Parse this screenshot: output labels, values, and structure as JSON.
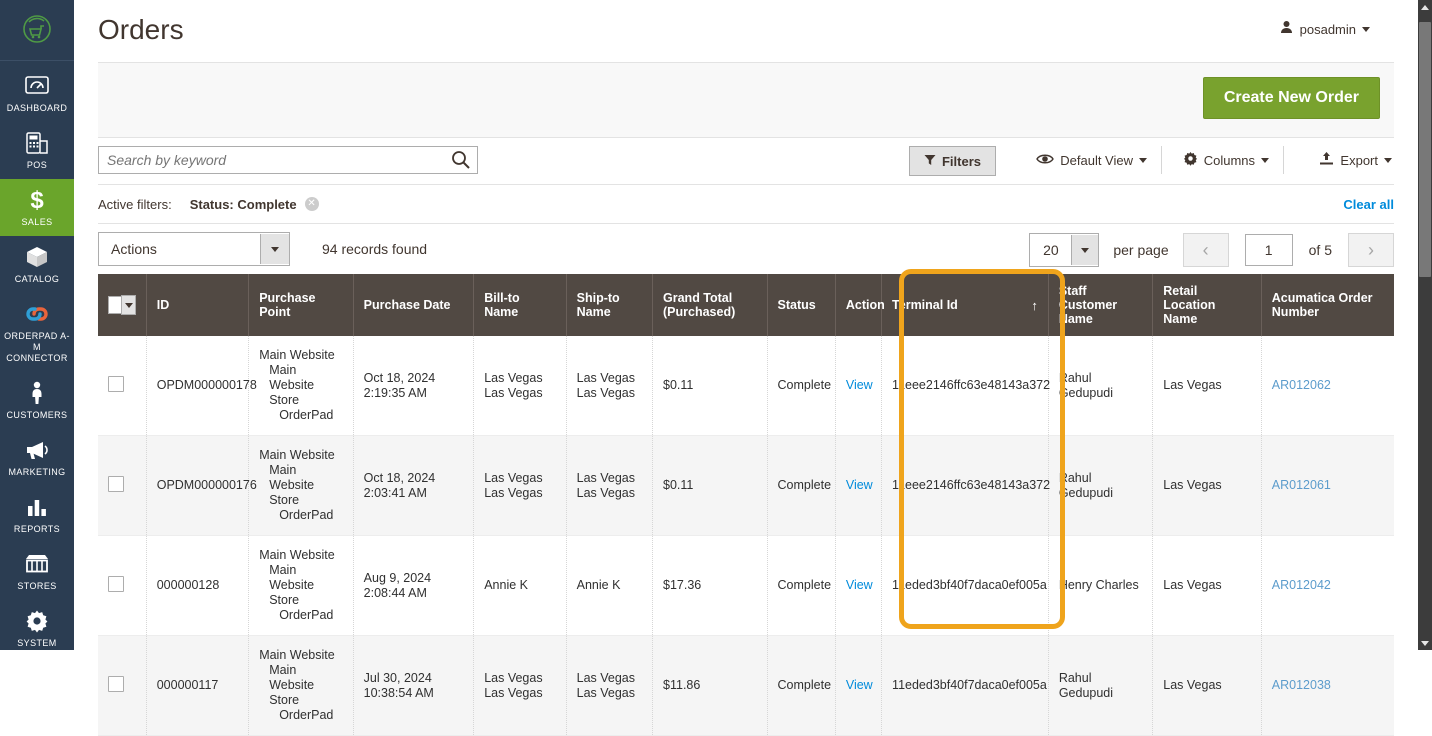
{
  "sidebar": {
    "logo_icon": "orderpad-logo-icon",
    "items": [
      {
        "label": "DASHBOARD",
        "icon": "dashboard-gauge-icon",
        "active": false
      },
      {
        "label": "POS",
        "icon": "pos-terminal-icon",
        "active": false
      },
      {
        "label": "SALES",
        "icon": "dollar-sign-icon",
        "active": true
      },
      {
        "label": "CATALOG",
        "icon": "box-icon",
        "active": false
      },
      {
        "label": "ORDERPAD A-M CONNECTOR",
        "icon": "link-chain-icon",
        "active": false
      },
      {
        "label": "CUSTOMERS",
        "icon": "person-icon",
        "active": false
      },
      {
        "label": "MARKETING",
        "icon": "megaphone-icon",
        "active": false
      },
      {
        "label": "REPORTS",
        "icon": "bar-chart-icon",
        "active": false
      },
      {
        "label": "STORES",
        "icon": "storefront-icon",
        "active": false
      },
      {
        "label": "SYSTEM",
        "icon": "gear-icon",
        "active": false
      }
    ]
  },
  "header": {
    "title": "Orders",
    "user_name": "posadmin"
  },
  "action_bar": {
    "create_order_label": "Create New Order"
  },
  "toolbar": {
    "search_placeholder": "Search by keyword",
    "search_value": "",
    "filters_label": "Filters",
    "default_view_label": "Default View",
    "columns_label": "Columns",
    "export_label": "Export"
  },
  "active_filters": {
    "label": "Active filters:",
    "chips": [
      "Status: Complete"
    ],
    "clear_all_label": "Clear all"
  },
  "pager": {
    "actions_label": "Actions",
    "records_found": "94 records found",
    "per_page_value": "20",
    "per_page_label": "per page",
    "page_value": "1",
    "of_label": "of 5"
  },
  "grid": {
    "columns": [
      "ID",
      "Purchase Point",
      "Purchase Date",
      "Bill-to Name",
      "Ship-to Name",
      "Grand Total (Purchased)",
      "Status",
      "Action",
      "Terminal Id",
      "Staff Customer Name",
      "Retail Location Name",
      "Acumatica Order Number"
    ],
    "sorted_column": "Terminal Id",
    "sort_direction": "ascending",
    "sort_glyph": "↑",
    "purchase_point_lines": [
      "Main Website",
      "Main Website Store",
      "OrderPad"
    ],
    "rows": [
      {
        "id": "OPDM000000178",
        "purchase_date_1": "Oct 18, 2024",
        "purchase_date_2": "2:19:35 AM",
        "bill_to": "Las Vegas Las Vegas",
        "ship_to": "Las Vegas Las Vegas",
        "grand_total": "$0.11",
        "status": "Complete",
        "action": "View",
        "terminal_id": "11eee2146ffc63e48143a372",
        "staff_customer": "Rahul Gedupudi",
        "retail_location": "Las Vegas",
        "acumatica_order": "AR012062"
      },
      {
        "id": "OPDM000000176",
        "purchase_date_1": "Oct 18, 2024",
        "purchase_date_2": "2:03:41 AM",
        "bill_to": "Las Vegas Las Vegas",
        "ship_to": "Las Vegas Las Vegas",
        "grand_total": "$0.11",
        "status": "Complete",
        "action": "View",
        "terminal_id": "11eee2146ffc63e48143a372",
        "staff_customer": "Rahul Gedupudi",
        "retail_location": "Las Vegas",
        "acumatica_order": "AR012061"
      },
      {
        "id": "000000128",
        "purchase_date_1": "Aug 9, 2024",
        "purchase_date_2": "2:08:44 AM",
        "bill_to": "Annie K",
        "ship_to": "Annie K",
        "grand_total": "$17.36",
        "status": "Complete",
        "action": "View",
        "terminal_id": "11eded3bf40f7daca0ef005a",
        "staff_customer": "Henry Charles",
        "retail_location": "Las Vegas",
        "acumatica_order": "AR012042"
      },
      {
        "id": "000000117",
        "purchase_date_1": "Jul 30, 2024",
        "purchase_date_2": "10:38:54 AM",
        "bill_to": "Las Vegas Las Vegas",
        "ship_to": "Las Vegas Las Vegas",
        "grand_total": "$11.86",
        "status": "Complete",
        "action": "View",
        "terminal_id": "11eded3bf40f7daca0ef005a",
        "staff_customer": "Rahul Gedupudi",
        "retail_location": "Las Vegas",
        "acumatica_order": "AR012038"
      }
    ]
  },
  "colors": {
    "sidebar_bg": "#2b3d52",
    "sidebar_active": "#6aa52b",
    "primary_button": "#79a22e",
    "table_header": "#514943",
    "link": "#008bdb",
    "highlight": "#efa41c"
  }
}
